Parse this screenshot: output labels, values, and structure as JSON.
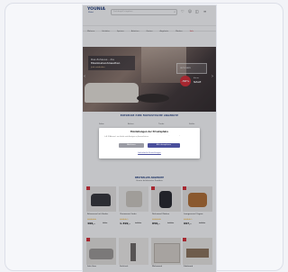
{
  "header": {
    "logo_text": "YOUNIA",
    "logo_sub": "Möbel",
    "search_placeholder": "Suchbegriff eingeben",
    "nav_items": [
      "Wohnen",
      "Schlafen",
      "Speisen",
      "Arbeiten",
      "Garten",
      "Angebote",
      "Marken",
      "Sale"
    ]
  },
  "hero": {
    "title_line1": "Das Zuhause – die",
    "title_line2": "Maximalwohnwelten",
    "cta_label": "Jetzt entdecken",
    "discount_label": "SALE",
    "discount_value": "-50%",
    "discount_sub": "bis zu",
    "promo_right": "GUTSCHEIN"
  },
  "section_heading": "ENTDECKE HIER FANTASTISCHE ANGEBOTE",
  "categories": [
    "Sofas",
    "Betten",
    "Tische",
    "Stühle"
  ],
  "consent": {
    "title": "Einstellungen der Privatsphäre",
    "body": "Wir verwenden Cookies und ähnliche Technologien auf unserer Webseite und verarbeiten personenbezogene Daten von dir (z.B. IP-Adresse), um Inhalte und Anzeigen zu personalisieren.",
    "deny_label": "Ablehnen",
    "accept_label": "Alle akzeptieren",
    "settings_label": "Individuelle Einstellungen"
  },
  "bestsellers": {
    "heading": "BESTSELLER ANGEBOTE",
    "sub": "Unsere beliebtesten Produkte",
    "products": [
      {
        "name": "Relaxsessel mit Hocker",
        "price": "499,-",
        "old": "899,-"
      },
      {
        "name": "Ohrensessel Leder",
        "price": "1.399,-",
        "old": "1.999,-"
      },
      {
        "name": "Drehsessel Modern",
        "price": "859,-",
        "old": "1.199,-"
      },
      {
        "name": "Loungesessel Cognac",
        "price": "997,-",
        "old": "1.499,-"
      }
    ],
    "products_row2": [
      {
        "name": "Sofa Grau"
      },
      {
        "name": "Stehtisch"
      },
      {
        "name": "Wohnwand"
      },
      {
        "name": "Sideboard"
      }
    ]
  },
  "colors": {
    "brand": "#1e3a7b",
    "accent": "#d7262e",
    "button": "#4a4f9c"
  }
}
